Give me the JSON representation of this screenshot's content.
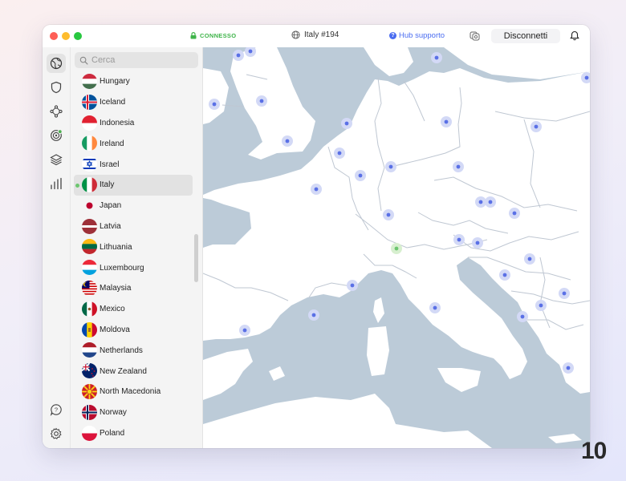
{
  "titlebar": {
    "status": "CONNESSO",
    "server": "Italy #194",
    "help_label": "Hub supporto",
    "disconnect_label": "Disconnetti"
  },
  "search": {
    "placeholder": "Cerca"
  },
  "countries": [
    {
      "name": "Hungary",
      "flag": "hungary"
    },
    {
      "name": "Iceland",
      "flag": "iceland"
    },
    {
      "name": "Indonesia",
      "flag": "indonesia"
    },
    {
      "name": "Ireland",
      "flag": "ireland"
    },
    {
      "name": "Israel",
      "flag": "israel"
    },
    {
      "name": "Italy",
      "flag": "italy",
      "selected": true,
      "connected": true
    },
    {
      "name": "Japan",
      "flag": "japan"
    },
    {
      "name": "Latvia",
      "flag": "latvia"
    },
    {
      "name": "Lithuania",
      "flag": "lithuania"
    },
    {
      "name": "Luxembourg",
      "flag": "luxembourg"
    },
    {
      "name": "Malaysia",
      "flag": "malaysia"
    },
    {
      "name": "Mexico",
      "flag": "mexico"
    },
    {
      "name": "Moldova",
      "flag": "moldova"
    },
    {
      "name": "Netherlands",
      "flag": "netherlands"
    },
    {
      "name": "New Zealand",
      "flag": "new-zealand"
    },
    {
      "name": "North Macedonia",
      "flag": "north-macedonia"
    },
    {
      "name": "Norway",
      "flag": "norway"
    },
    {
      "name": "Poland",
      "flag": "poland"
    }
  ],
  "colors": {
    "accent": "#4a6cf0",
    "connected": "#3fb44a",
    "sea": "#bccbd8",
    "land": "#ffffff",
    "server_pin": "#5a70e6"
  },
  "logo": "10"
}
